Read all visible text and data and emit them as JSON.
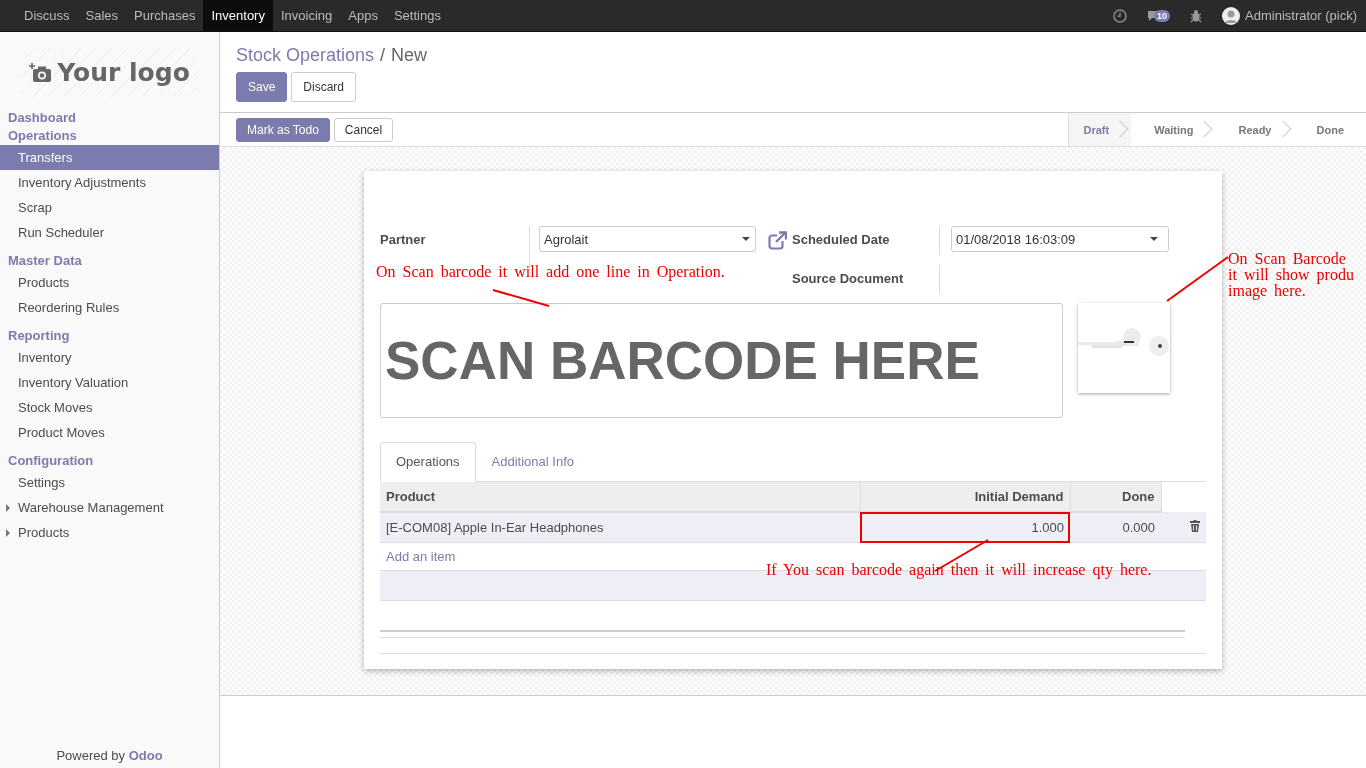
{
  "topbar": {
    "apps": [
      {
        "label": "Discuss",
        "selected": false
      },
      {
        "label": "Sales",
        "selected": false
      },
      {
        "label": "Purchases",
        "selected": false
      },
      {
        "label": "Inventory",
        "selected": true
      },
      {
        "label": "Invoicing",
        "selected": false
      },
      {
        "label": "Apps",
        "selected": false
      },
      {
        "label": "Settings",
        "selected": false
      }
    ],
    "messages_badge": "10",
    "user": "Administrator (pick)"
  },
  "sidebar": {
    "logo_text": "Your logo",
    "sections": [
      {
        "title": "Dashboard"
      },
      {
        "title": "Operations",
        "items": [
          {
            "label": "Transfers",
            "selected": true,
            "kind": "link"
          },
          {
            "label": "Inventory Adjustments",
            "selected": false,
            "kind": "link"
          },
          {
            "label": "Scrap",
            "selected": false,
            "kind": "link"
          },
          {
            "label": "Run Scheduler",
            "selected": false,
            "kind": "link"
          }
        ]
      },
      {
        "title": "Master Data",
        "items": [
          {
            "label": "Products",
            "selected": false,
            "kind": "link"
          },
          {
            "label": "Reordering Rules",
            "selected": false,
            "kind": "link"
          }
        ]
      },
      {
        "title": "Reporting",
        "items": [
          {
            "label": "Inventory",
            "selected": false,
            "kind": "link"
          },
          {
            "label": "Inventory Valuation",
            "selected": false,
            "kind": "link"
          },
          {
            "label": "Stock Moves",
            "selected": false,
            "kind": "link"
          },
          {
            "label": "Product Moves",
            "selected": false,
            "kind": "link"
          }
        ]
      },
      {
        "title": "Configuration",
        "items": [
          {
            "label": "Settings",
            "selected": false,
            "kind": "link"
          },
          {
            "label": "Warehouse Management",
            "selected": false,
            "kind": "folder"
          },
          {
            "label": "Products",
            "selected": false,
            "kind": "folder"
          }
        ]
      }
    ],
    "footer": "Powered by **Odoo**"
  },
  "breadcrumb": {
    "parent": "Stock Operations",
    "separator": "/",
    "current": "New"
  },
  "control_buttons": [
    {
      "label": "Save",
      "kind": "primary"
    },
    {
      "label": "Discard",
      "kind": "secondary"
    }
  ],
  "action_buttons": [
    {
      "label": "Mark as Todo",
      "kind": "primary"
    },
    {
      "label": "Cancel",
      "kind": "secondary"
    }
  ],
  "status_steps": [
    {
      "label": "Draft",
      "selected": true
    },
    {
      "label": "Waiting",
      "selected": false
    },
    {
      "label": "Ready",
      "selected": false
    },
    {
      "label": "Done",
      "selected": false
    }
  ],
  "form": {
    "left_fields": [
      {
        "label": "Partner",
        "value": "Agrolait"
      }
    ],
    "right_fields": [
      {
        "label": "Scheduled Date",
        "value": "01/08/2018 16:03:09"
      },
      {
        "label": "Source Document"
      }
    ],
    "barcode": {
      "placeholder": "SCAN BARCODE HERE"
    }
  },
  "tabs": [
    {
      "label": "Operations",
      "selected": true
    },
    {
      "label": "Additional Info",
      "selected": false
    }
  ],
  "table": {
    "columns": [
      "Product",
      "Initial Demand",
      "Done"
    ],
    "rows": [
      {
        "product": "[E-COM08] Apple In-Ear Headphones",
        "initial_demand": "1.000",
        "done": "0.000",
        "demand_highlighted": true
      }
    ],
    "add_item": "Add an item"
  },
  "annotations": [
    {
      "text": "On Scan barcode it will add one line in Operation."
    },
    {
      "text": "On Scan Barcode\nit will show produ\nimage here."
    },
    {
      "text": "If You scan barcode again then it will increase qty here."
    }
  ]
}
